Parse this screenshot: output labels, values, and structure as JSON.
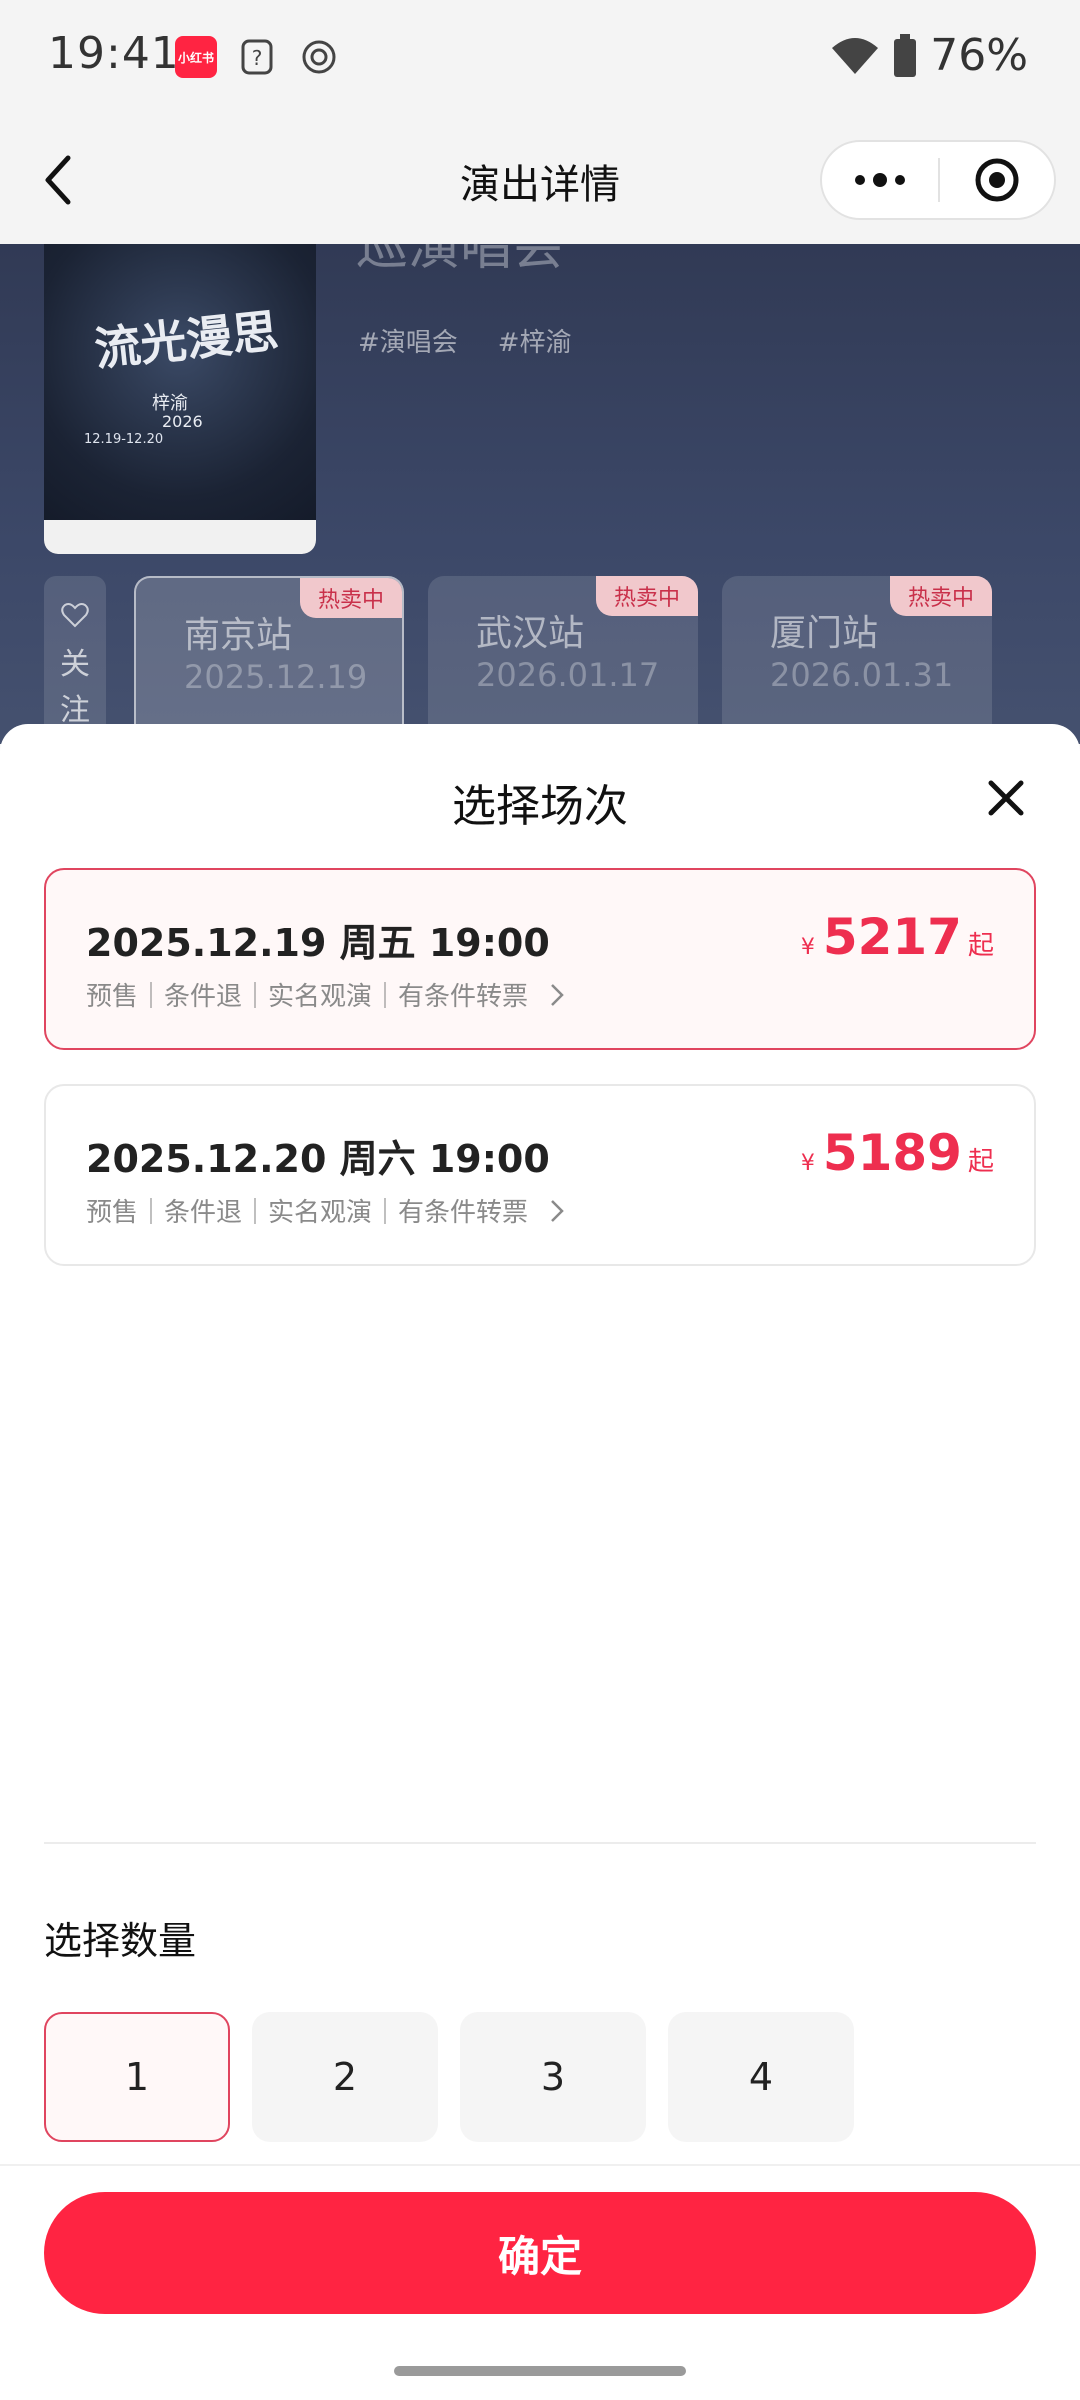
{
  "status_bar": {
    "time": "19:41",
    "app_badge": "小红书",
    "battery": "76%",
    "icons": [
      "question-icon",
      "settings-ring-icon",
      "wifi-icon",
      "battery-icon"
    ]
  },
  "nav": {
    "title": "演出详情",
    "icons": [
      "back-icon",
      "more-icon",
      "target-icon"
    ]
  },
  "background": {
    "heading_partial": "巡演唱会",
    "poster": {
      "title": "流光漫思",
      "artist": "梓渝",
      "year_line": "2026",
      "dates": "12.19-12.20"
    },
    "tags": [
      "#演唱会",
      "#梓渝"
    ],
    "follow_label": "关注",
    "cities": [
      {
        "name": "南京站",
        "date": "2025.12.19",
        "badge": "热卖中"
      },
      {
        "name": "武汉站",
        "date": "2026.01.17",
        "badge": "热卖中"
      },
      {
        "name": "厦门站",
        "date": "2026.01.31",
        "badge": "热卖中"
      }
    ]
  },
  "sheet": {
    "title": "选择场次",
    "sessions": [
      {
        "datetime": "2025.12.19 周五 19:00",
        "terms": "预售｜条件退｜实名观演｜有条件转票",
        "currency": "¥",
        "price": "5217",
        "price_suffix": "起",
        "selected": true
      },
      {
        "datetime": "2025.12.20 周六 19:00",
        "terms": "预售｜条件退｜实名观演｜有条件转票",
        "currency": "¥",
        "price": "5189",
        "price_suffix": "起",
        "selected": false
      }
    ],
    "quantity_label": "选择数量",
    "quantities": [
      "1",
      "2",
      "3",
      "4"
    ],
    "selected_quantity": "1",
    "confirm_label": "确定"
  },
  "colors": {
    "accent": "#ff2442",
    "price": "#ee2e4f",
    "selected_border": "#e0455f",
    "selected_bg": "#fff8f8"
  }
}
